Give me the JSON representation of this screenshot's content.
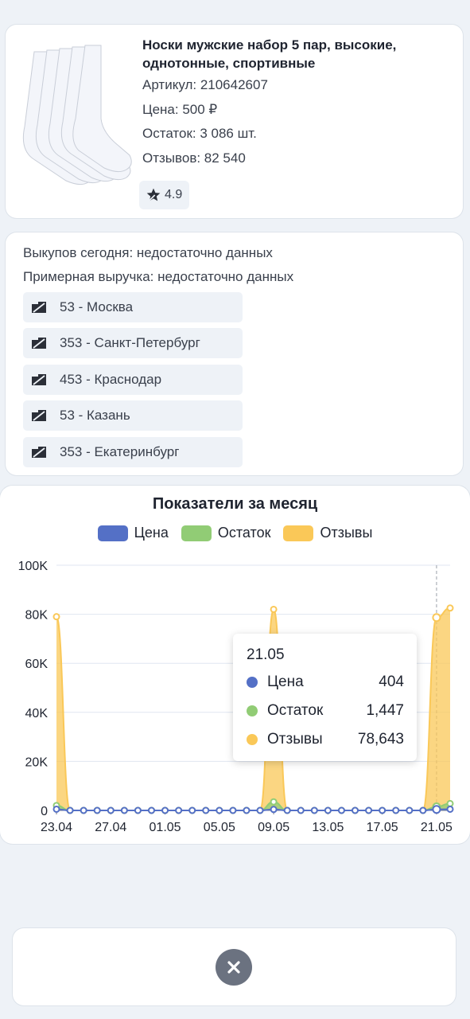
{
  "product": {
    "title_line1": "Носки мужские набор 5 пар, высокие,",
    "title_line2": "однотонные, спортивные",
    "article": "Артикул: 210642607",
    "price": "Цена: 500 ₽",
    "stock": "Остаток: 3 086 шт.",
    "reviews": "Отзывов: 82 540",
    "rating": "4.9",
    "image_icon": "socks-image",
    "rating_icon": "star-icon"
  },
  "sales": {
    "buyouts": "Выкупов сегодня: недостаточно данных",
    "revenue": "Примерная выручка: недостаточно данных",
    "cities": [
      {
        "label": "53 - Москва",
        "icon": "truck-icon"
      },
      {
        "label": "353 - Санкт-Петербург",
        "icon": "truck-icon"
      },
      {
        "label": "453 - Краснодар",
        "icon": "truck-icon"
      },
      {
        "label": "53 - Казань",
        "icon": "truck-icon"
      },
      {
        "label": "353 - Екатеринбург",
        "icon": "truck-icon"
      }
    ]
  },
  "tooltip": {
    "date": "21.05",
    "rows": [
      {
        "name": "Цена",
        "value": "404",
        "color": "#5470c6"
      },
      {
        "name": "Остаток",
        "value": "1,447",
        "color": "#91cc75"
      },
      {
        "name": "Отзывы",
        "value": "78,643",
        "color": "#fac858"
      }
    ]
  },
  "chart_data": {
    "type": "area",
    "title": "Показатели за месяц",
    "legend_position": "top-center",
    "grid": true,
    "ylim": [
      0,
      100000
    ],
    "yticks": [
      0,
      20000,
      40000,
      60000,
      80000,
      100000
    ],
    "ytick_labels": [
      "0",
      "20K",
      "40K",
      "60K",
      "80K",
      "100K"
    ],
    "xtick_labels": [
      "23.04",
      "27.04",
      "01.05",
      "05.05",
      "09.05",
      "13.05",
      "17.05",
      "21.05"
    ],
    "x": [
      "23.04",
      "24.04",
      "25.04",
      "26.04",
      "27.04",
      "28.04",
      "29.04",
      "30.04",
      "01.05",
      "02.05",
      "03.05",
      "04.05",
      "05.05",
      "06.05",
      "07.05",
      "08.05",
      "09.05",
      "10.05",
      "11.05",
      "12.05",
      "13.05",
      "14.05",
      "15.05",
      "16.05",
      "17.05",
      "18.05",
      "19.05",
      "20.05",
      "21.05",
      "22.05"
    ],
    "series": [
      {
        "name": "Цена",
        "color": "#5470c6",
        "values": [
          500,
          0,
          0,
          0,
          0,
          0,
          0,
          0,
          0,
          0,
          0,
          0,
          0,
          0,
          0,
          0,
          400,
          0,
          0,
          0,
          0,
          0,
          0,
          0,
          0,
          0,
          0,
          0,
          404,
          500
        ]
      },
      {
        "name": "Остаток",
        "color": "#91cc75",
        "values": [
          2000,
          0,
          0,
          0,
          0,
          0,
          0,
          0,
          0,
          0,
          0,
          0,
          0,
          0,
          0,
          0,
          3500,
          0,
          0,
          0,
          0,
          0,
          0,
          0,
          0,
          0,
          0,
          0,
          1447,
          2800
        ]
      },
      {
        "name": "Отзывы",
        "color": "#fac858",
        "values": [
          79000,
          0,
          0,
          0,
          0,
          0,
          0,
          0,
          0,
          0,
          0,
          0,
          0,
          0,
          0,
          0,
          82000,
          0,
          0,
          0,
          0,
          0,
          0,
          0,
          0,
          0,
          0,
          0,
          78643,
          82540
        ]
      }
    ],
    "highlight_index": 28
  },
  "colors": {
    "background": "#eef2f7",
    "card": "#ffffff",
    "close_button": "#6b7280"
  },
  "close_icon": "close-icon"
}
